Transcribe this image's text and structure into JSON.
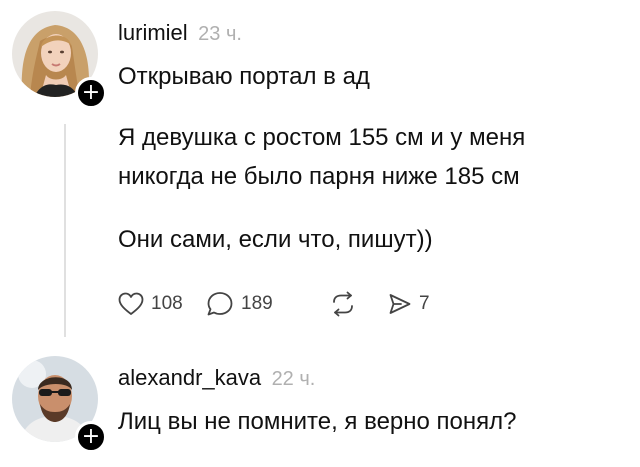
{
  "comments": [
    {
      "username": "lurimiel",
      "time": "23 ч.",
      "title": "Открываю портал в ад",
      "body_lines": [
        "Я девушка с ростом 155 см и у меня",
        "никогда не было парня ниже 185 см"
      ],
      "followup": "Они сами, если что, пишут))",
      "actions": {
        "likes": "108",
        "replies": "189",
        "reposts": "",
        "shares": "7"
      },
      "follow_badge": "+"
    },
    {
      "username": "alexandr_kava",
      "time": "22 ч.",
      "title": "Лиц вы не помните, я верно понял?",
      "follow_badge": "+"
    }
  ],
  "icons": {
    "like": "heart-icon",
    "reply": "speech-bubble-icon",
    "repost": "repost-arrows-icon",
    "share": "send-arrow-icon"
  }
}
